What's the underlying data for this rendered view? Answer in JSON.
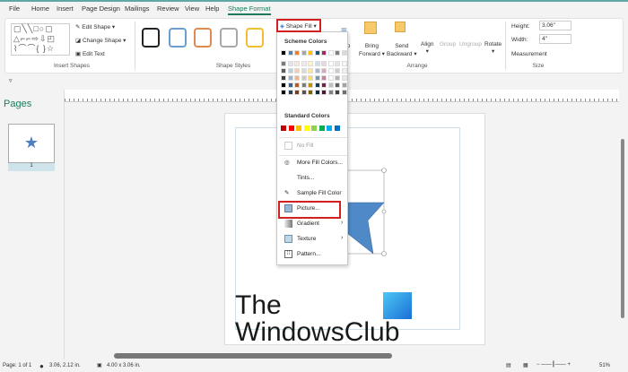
{
  "tabs": [
    "File",
    "Home",
    "Insert",
    "Page Design",
    "Mailings",
    "Review",
    "View",
    "Help",
    "Shape Format"
  ],
  "ribbon": {
    "insert_shapes": {
      "edit_shape": "Edit Shape",
      "change_shape": "Change Shape",
      "edit_text": "Edit Text",
      "label": "Insert Shapes"
    },
    "shape_styles": {
      "label": "Shape Styles",
      "styles": [
        "#333333",
        "#6a9fd0",
        "#e08a50",
        "#a0a0a0",
        "#f0c030"
      ]
    },
    "shape_fill": "Shape Fill",
    "arrange": {
      "wrap": "Wrap",
      "bring_forward": [
        "Bring",
        "Forward"
      ],
      "send_backward": [
        "Send",
        "Backward"
      ],
      "align": "Align",
      "group": "Group",
      "ungroup": "Ungroup",
      "rotate": "Rotate",
      "label": "Arrange"
    },
    "size": {
      "height_label": "Height:",
      "height_value": "3.06\"",
      "width_label": "Width:",
      "width_value": "4\"",
      "measurement": "Measurement",
      "label": "Size"
    }
  },
  "dropdown": {
    "scheme_label": "Scheme Colors",
    "scheme_colors": [
      "#000000",
      "#5b7fa6",
      "#ed7d31",
      "#a5a5a5",
      "#ffc000",
      "#1f4e79",
      "#9b2c5f",
      "#ffffff",
      "#7f7f7f",
      "#d9d9d9"
    ],
    "standard_label": "Standard Colors",
    "standard_colors": [
      "#c00000",
      "#ff0000",
      "#ffc000",
      "#ffff00",
      "#92d050",
      "#00b050",
      "#00b0f0",
      "#0070c0"
    ],
    "items": [
      "No Fill",
      "More Fill Colors...",
      "Tints...",
      "Sample Fill Color",
      "Picture...",
      "Gradient",
      "Texture",
      "Pattern..."
    ]
  },
  "pages": {
    "title": "Pages",
    "thumb_number": "1"
  },
  "watermark": [
    "The",
    "WindowsClub"
  ],
  "status": {
    "page": "Page: 1 of 1",
    "position": "3.06, 2.12 in.",
    "size": "4.00 x 3.06 in.",
    "zoom": "51%"
  },
  "accent": "#2e8b57"
}
